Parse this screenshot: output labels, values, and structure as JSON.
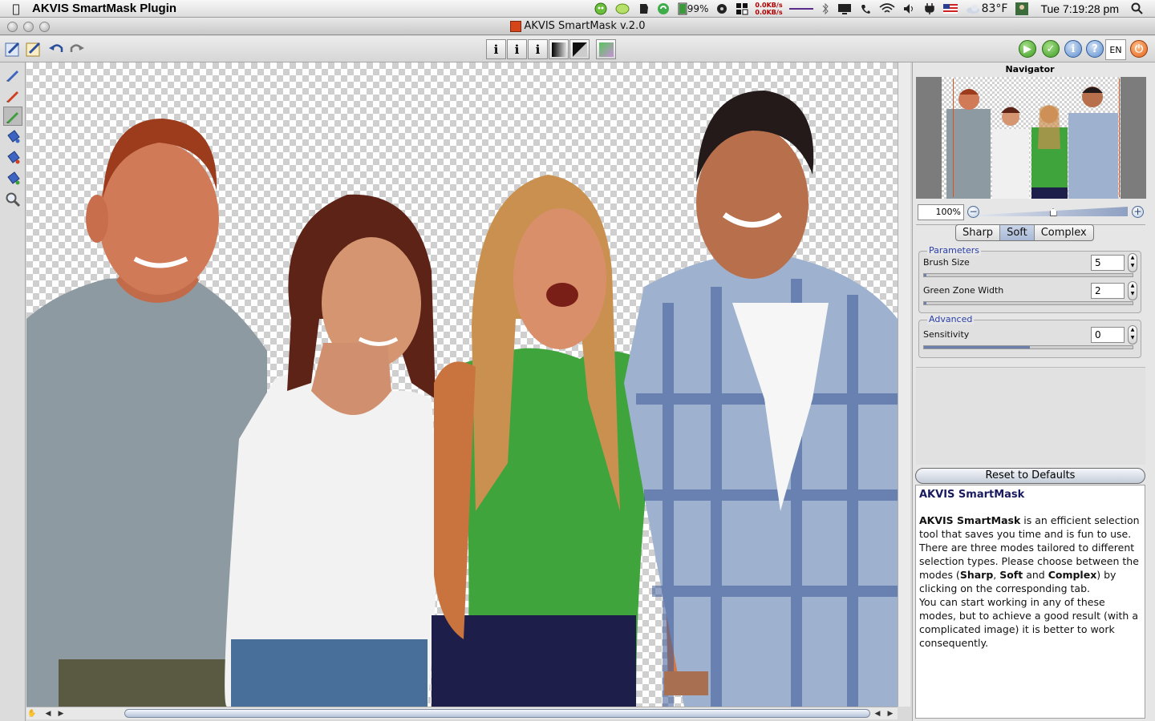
{
  "menubar": {
    "app_name": "AKVIS SmartMask Plugin",
    "net_up": "0.0KB/s",
    "net_down": "0.0KB/s",
    "battery": "99%",
    "temperature": "83°F",
    "clock": "Tue 7:19:28 pm"
  },
  "window": {
    "title": "AKVIS SmartMask v.2.0"
  },
  "toolbar": {
    "mode_buttons": [
      "i",
      "i",
      "i"
    ],
    "lang": "EN"
  },
  "navigator": {
    "title": "Navigator",
    "zoom": "100%",
    "zoom_level_fraction": 0.5
  },
  "tabs": [
    "Sharp",
    "Soft",
    "Complex"
  ],
  "active_tab": "Soft",
  "parameters": {
    "title": "Parameters",
    "brush_size_label": "Brush Size",
    "brush_size": "5",
    "green_zone_label": "Green Zone Width",
    "green_zone": "2"
  },
  "advanced": {
    "title": "Advanced",
    "sensitivity_label": "Sensitivity",
    "sensitivity": "0"
  },
  "reset_label": "Reset to Defaults",
  "help": {
    "title": "AKVIS SmartMask",
    "p1_bold": "AKVIS SmartMask",
    "p1_rest": " is an efficient selection tool that saves you time and is fun to use. There are three modes tailored to different selection types. Please choose between the modes (",
    "m1": "Sharp",
    "sep1": ", ",
    "m2": "Soft",
    "sep2": " and ",
    "m3": "Complex",
    "p1_end": ") by clicking on the corresponding tab.",
    "p2": "You can start working in any of these modes, but to achieve a good result (with a complicated image) it is better to work consequently."
  },
  "colors": {
    "accent_blue": "#2a3ea8",
    "logo_orange": "#d6451a",
    "run_green": "#4bae2e"
  }
}
